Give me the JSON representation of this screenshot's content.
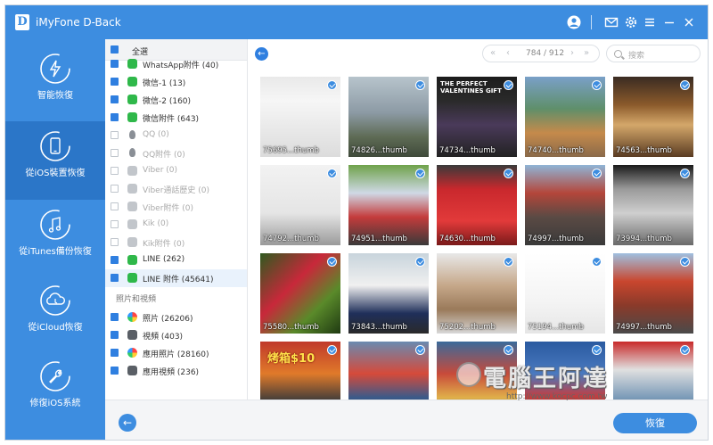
{
  "app": {
    "title": "iMyFone D-Back",
    "logo_letter": "D"
  },
  "titlebar": {
    "icons": [
      "user-icon",
      "mail-icon",
      "settings-icon",
      "menu-icon",
      "minimize-icon",
      "close-icon"
    ]
  },
  "nav": {
    "items": [
      {
        "label": "智能恢復",
        "icon": "lightning-refresh-icon"
      },
      {
        "label": "從iOS裝置恢復",
        "icon": "phone-refresh-icon"
      },
      {
        "label": "從iTunes備份恢復",
        "icon": "music-note-icon"
      },
      {
        "label": "從iCloud恢復",
        "icon": "cloud-refresh-icon"
      },
      {
        "label": "修復iOS系統",
        "icon": "wrench-icon"
      }
    ]
  },
  "categories": {
    "select_all": "全選",
    "items": [
      {
        "label": "WhatsApp附件 (40)",
        "icon": "green",
        "checked": true,
        "dim": false
      },
      {
        "label": "微信-1 (13)",
        "icon": "green",
        "checked": true,
        "dim": false
      },
      {
        "label": "微信-2 (160)",
        "icon": "green",
        "checked": true,
        "dim": false
      },
      {
        "label": "微信附件 (643)",
        "icon": "green",
        "checked": true,
        "dim": false
      },
      {
        "label": "QQ (0)",
        "icon": "qq",
        "checked": false,
        "dim": true
      },
      {
        "label": "QQ附件 (0)",
        "icon": "qq",
        "checked": false,
        "dim": true
      },
      {
        "label": "Viber (0)",
        "icon": "grey",
        "checked": false,
        "dim": true
      },
      {
        "label": "Viber通話歷史 (0)",
        "icon": "grey",
        "checked": false,
        "dim": true
      },
      {
        "label": "Viber附件 (0)",
        "icon": "grey",
        "checked": false,
        "dim": true
      },
      {
        "label": "Kik (0)",
        "icon": "grey",
        "checked": false,
        "dim": true
      },
      {
        "label": "Kik附件 (0)",
        "icon": "grey",
        "checked": false,
        "dim": true
      },
      {
        "label": "LINE (262)",
        "icon": "green",
        "checked": true,
        "dim": false
      },
      {
        "label": "LINE 附件 (45641)",
        "icon": "green",
        "checked": true,
        "dim": false
      }
    ],
    "section_photos": "照片和視頻",
    "photo_items": [
      {
        "label": "照片 (26206)",
        "icon": "photo",
        "checked": true
      },
      {
        "label": "視頻 (403)",
        "icon": "video",
        "checked": true
      },
      {
        "label": "應用照片 (28160)",
        "icon": "photo",
        "checked": true
      },
      {
        "label": "應用視頻 (236)",
        "icon": "video",
        "checked": true
      }
    ]
  },
  "pager": {
    "text": "784 / 912"
  },
  "search": {
    "placeholder": "搜索"
  },
  "photos": [
    {
      "name": "75695...thumb",
      "bg": "linear-gradient(180deg,#e9e9e9 0%,#f6f6f6 30%,#dcdcdc 100%)",
      "accent": "#e86a2a"
    },
    {
      "name": "74826...thumb",
      "bg": "linear-gradient(180deg,#b7c4cc 0%,#8c9aa4 45%,#5e6b55 75%,#3f4a3a 100%)",
      "accent": ""
    },
    {
      "name": "74734...thumb",
      "bg": "linear-gradient(180deg,#1c1c1c 0%,#2a2a2a 30%,#4a3a5a 60%,#222 100%)",
      "accent": "#9b5fb8"
    },
    {
      "name": "74740...thumb",
      "bg": "linear-gradient(180deg,#7aa0c8 0%,#5f8f6a 40%,#c58a4b 70%,#8a6a4a 100%)",
      "accent": ""
    },
    {
      "name": "74563...thumb",
      "bg": "linear-gradient(180deg,#3a2b22 0%,#8b5a2b 35%,#d4a76a 60%,#5a3b22 100%)",
      "accent": ""
    },
    {
      "name": "74792...thumb",
      "bg": "linear-gradient(180deg,#f2f2f2 0%,#e5e5e5 60%,#9a9a9a 100%)",
      "accent": ""
    },
    {
      "name": "74951...thumb",
      "bg": "linear-gradient(180deg,#6fa24a 0%,#cfd9e6 35%,#c43b3b 65%,#3a3a3a 100%)",
      "accent": ""
    },
    {
      "name": "74630...thumb",
      "bg": "linear-gradient(180deg,#3a3a3a 0%,#c9282d 30%,#e23a3a 70%,#7a1a1a 100%)",
      "accent": ""
    },
    {
      "name": "74997...thumb",
      "bg": "linear-gradient(180deg,#8fb4d6 0%,#b4463a 35%,#5a4a44 65%,#3a3a3a 100%)",
      "accent": ""
    },
    {
      "name": "73994...thumb",
      "bg": "linear-gradient(180deg,#1a1a1a 0%,#9a9a9a 30%,#cfcfcf 60%,#6a6a6a 100%)",
      "accent": ""
    },
    {
      "name": "75580...thumb",
      "bg": "linear-gradient(135deg,#2f5a1f 0%,#c8283a 40%,#5a8a2a 70%,#1f3a12 100%)",
      "accent": ""
    },
    {
      "name": "73843...thumb",
      "bg": "linear-gradient(180deg,#c8d4dc 0%,#f0f0f0 40%,#1f2f5a 75%,#2a2a2a 100%)",
      "accent": ""
    },
    {
      "name": "75202...thumb",
      "bg": "linear-gradient(180deg,#e8e8e8 0%,#c6a88a 40%,#9a7a5a 70%,#d8d8d8 100%)",
      "accent": ""
    },
    {
      "name": "75194...thumb",
      "bg": "linear-gradient(180deg,#ffffff 0%,#f4f4f4 60%,#e6e6e6 100%)",
      "accent": ""
    },
    {
      "name": "74997...thumb",
      "bg": "linear-gradient(180deg,#9fc0e0 0%,#c9462e 35%,#8a3a2a 65%,#4a4a4a 100%)",
      "accent": ""
    },
    {
      "name": "",
      "bg": "linear-gradient(180deg,#c0392b 0%,#e07a2a 40%,#3a3a3a 75%,#1a1a1a 100%)",
      "accent": ""
    },
    {
      "name": "",
      "bg": "linear-gradient(180deg,#6a8ab0 0%,#d64a3a 40%,#3a5a8a 70%,#2a2a2a 100%)",
      "accent": ""
    },
    {
      "name": "",
      "bg": "linear-gradient(180deg,#3a6a9a 0%,#c84a3a 40%,#e0b04a 70%,#3a3a3a 100%)",
      "accent": ""
    },
    {
      "name": "",
      "bg": "linear-gradient(180deg,#2a5aa0 0%,#4a7ac0 40%,#c83a3a 70%,#2a2a2a 100%)",
      "accent": ""
    },
    {
      "name": "",
      "bg": "linear-gradient(180deg,#c82a2a 0%,#e0e0e0 35%,#7a9ab8 70%,#4a4a4a 100%)",
      "accent": ""
    }
  ],
  "tile15_text": "烤箱$10",
  "tile3_text": "THE PERFECT VALENTINES GIFT",
  "footer": {
    "recover_label": "恢復"
  },
  "watermark": {
    "main": "電腦王阿達",
    "url": "http://www.kocpc.com.tw"
  },
  "colors": {
    "brand": "#3d8de0",
    "nav_active": "#2b76c8",
    "check": "#2f7fe0"
  }
}
